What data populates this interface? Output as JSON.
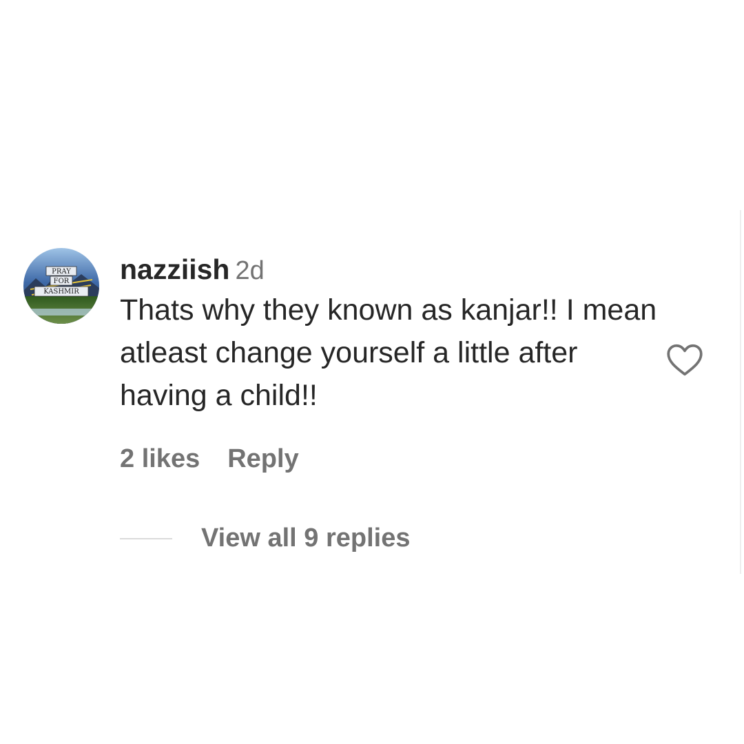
{
  "comment": {
    "avatar": {
      "icon": "avatar-pray-for-kashmir",
      "lines": [
        "PRAY",
        "FOR",
        "KASHMIR"
      ]
    },
    "username": "nazziish",
    "timestamp": "2d",
    "text": "Thats why they known as kanjar!! I mean atleast change yourself a little after having a child!!",
    "likes": "2 likes",
    "reply_label": "Reply",
    "like_icon": "heart-outline-icon",
    "view_replies": "View all 9 replies"
  },
  "colors": {
    "primary_text": "#262626",
    "secondary_text": "#737373",
    "divider": "#dbdbdb",
    "background": "#ffffff"
  }
}
